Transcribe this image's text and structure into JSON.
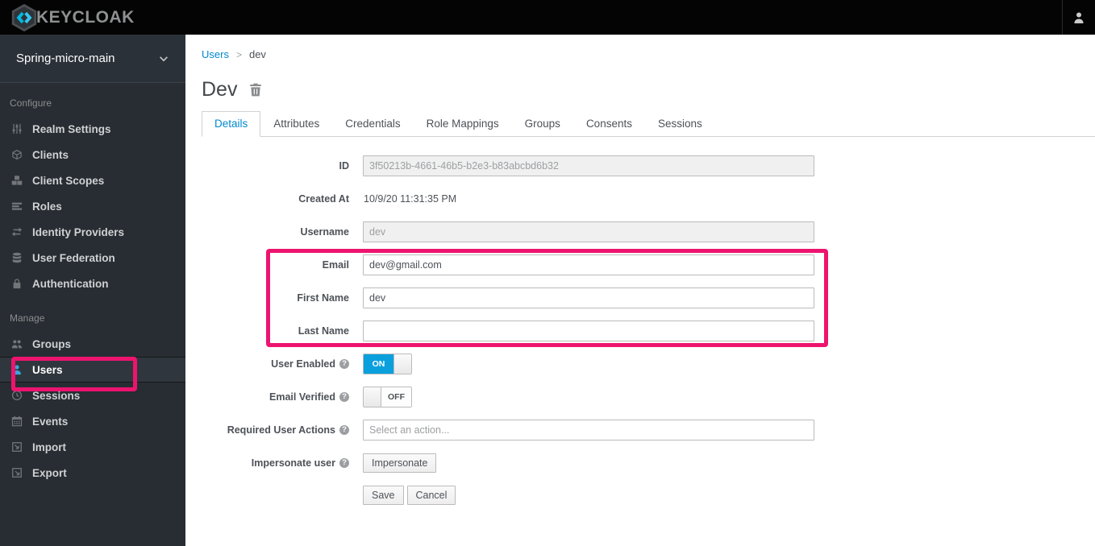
{
  "brand": {
    "name": "KEYCLOAK"
  },
  "sidebar": {
    "realm_selector": {
      "label": "Spring-micro-main"
    },
    "sections": [
      {
        "heading": "Configure",
        "items": [
          {
            "label": "Realm Settings",
            "icon": "sliders-icon"
          },
          {
            "label": "Clients",
            "icon": "cube-icon"
          },
          {
            "label": "Client Scopes",
            "icon": "cubes-icon"
          },
          {
            "label": "Roles",
            "icon": "list-icon"
          },
          {
            "label": "Identity Providers",
            "icon": "exchange-icon"
          },
          {
            "label": "User Federation",
            "icon": "database-icon"
          },
          {
            "label": "Authentication",
            "icon": "lock-icon"
          }
        ]
      },
      {
        "heading": "Manage",
        "items": [
          {
            "label": "Groups",
            "icon": "group-icon"
          },
          {
            "label": "Users",
            "icon": "user-icon",
            "active": true
          },
          {
            "label": "Sessions",
            "icon": "clock-icon"
          },
          {
            "label": "Events",
            "icon": "calendar-icon"
          },
          {
            "label": "Import",
            "icon": "import-icon"
          },
          {
            "label": "Export",
            "icon": "export-icon"
          }
        ]
      }
    ]
  },
  "breadcrumb": {
    "parent": "Users",
    "separator": ">",
    "current": "dev"
  },
  "page": {
    "title": "Dev"
  },
  "tabs": [
    {
      "label": "Details",
      "active": true
    },
    {
      "label": "Attributes"
    },
    {
      "label": "Credentials"
    },
    {
      "label": "Role Mappings"
    },
    {
      "label": "Groups"
    },
    {
      "label": "Consents"
    },
    {
      "label": "Sessions"
    }
  ],
  "form": {
    "id": {
      "label": "ID",
      "value": "3f50213b-4661-46b5-b2e3-b83abcbd6b32",
      "disabled": true
    },
    "created_at": {
      "label": "Created At",
      "value": "10/9/20 11:31:35 PM"
    },
    "username": {
      "label": "Username",
      "value": "dev",
      "disabled": true
    },
    "email": {
      "label": "Email",
      "value": "dev@gmail.com"
    },
    "first_name": {
      "label": "First Name",
      "value": "dev"
    },
    "last_name": {
      "label": "Last Name",
      "value": ""
    },
    "user_enabled": {
      "label": "User Enabled",
      "state": "ON"
    },
    "email_verified": {
      "label": "Email Verified",
      "state": "OFF"
    },
    "required_user_actions": {
      "label": "Required User Actions",
      "placeholder": "Select an action..."
    },
    "impersonate_user": {
      "label": "Impersonate user",
      "button_label": "Impersonate"
    },
    "actions": {
      "save_label": "Save",
      "cancel_label": "Cancel"
    }
  },
  "icons": {
    "help_glyph": "?"
  },
  "colors": {
    "link_blue": "#0088ce",
    "toggle_on_blue": "#0aa0dd",
    "sidebar_active_icon": "#39a5dc",
    "annotation_pink": "#ed146f",
    "header_black": "#040404",
    "sidebar_dark": "#282d33"
  }
}
